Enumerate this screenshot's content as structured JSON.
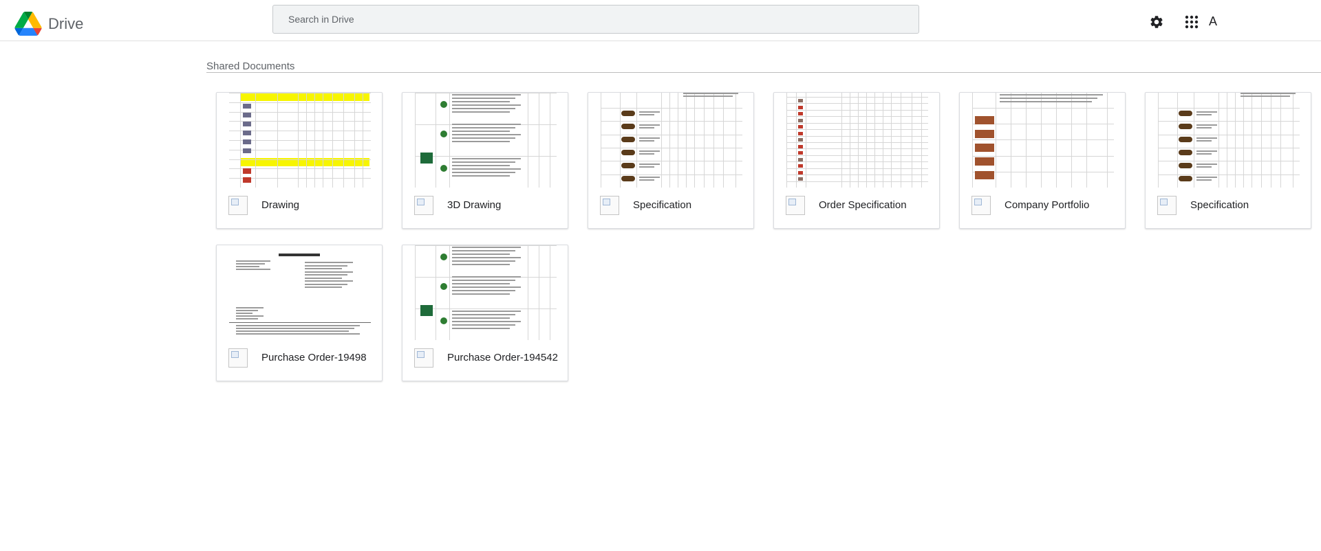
{
  "app": {
    "brand": "Drive"
  },
  "search": {
    "placeholder": "Search in Drive"
  },
  "header": {
    "avatar_initial": "A"
  },
  "section": {
    "title": "Shared Documents"
  },
  "files": [
    {
      "title": "Drawing",
      "thumbnail": "yellow-header-table"
    },
    {
      "title": "3D Drawing",
      "thumbnail": "product-text-table"
    },
    {
      "title": "Specification",
      "thumbnail": "tin-list-table"
    },
    {
      "title": "Order Specification",
      "thumbnail": "dense-list-table"
    },
    {
      "title": "Company Portfolio",
      "thumbnail": "portfolio-table"
    },
    {
      "title": "Specification",
      "thumbnail": "tin-list-table"
    },
    {
      "title": "Purchase Order-19498",
      "thumbnail": "purchase-order-doc"
    },
    {
      "title": "Purchase Order-194542",
      "thumbnail": "product-text-table"
    }
  ],
  "icons": {
    "settings": "gear-icon",
    "apps": "apps-grid-icon",
    "logo": "drive-logo-icon",
    "file": "broken-image-icon"
  },
  "colors": {
    "topbar_border": "#e0e0e0",
    "search_bg": "#f1f3f4",
    "yellow_header": "#f7f500"
  }
}
